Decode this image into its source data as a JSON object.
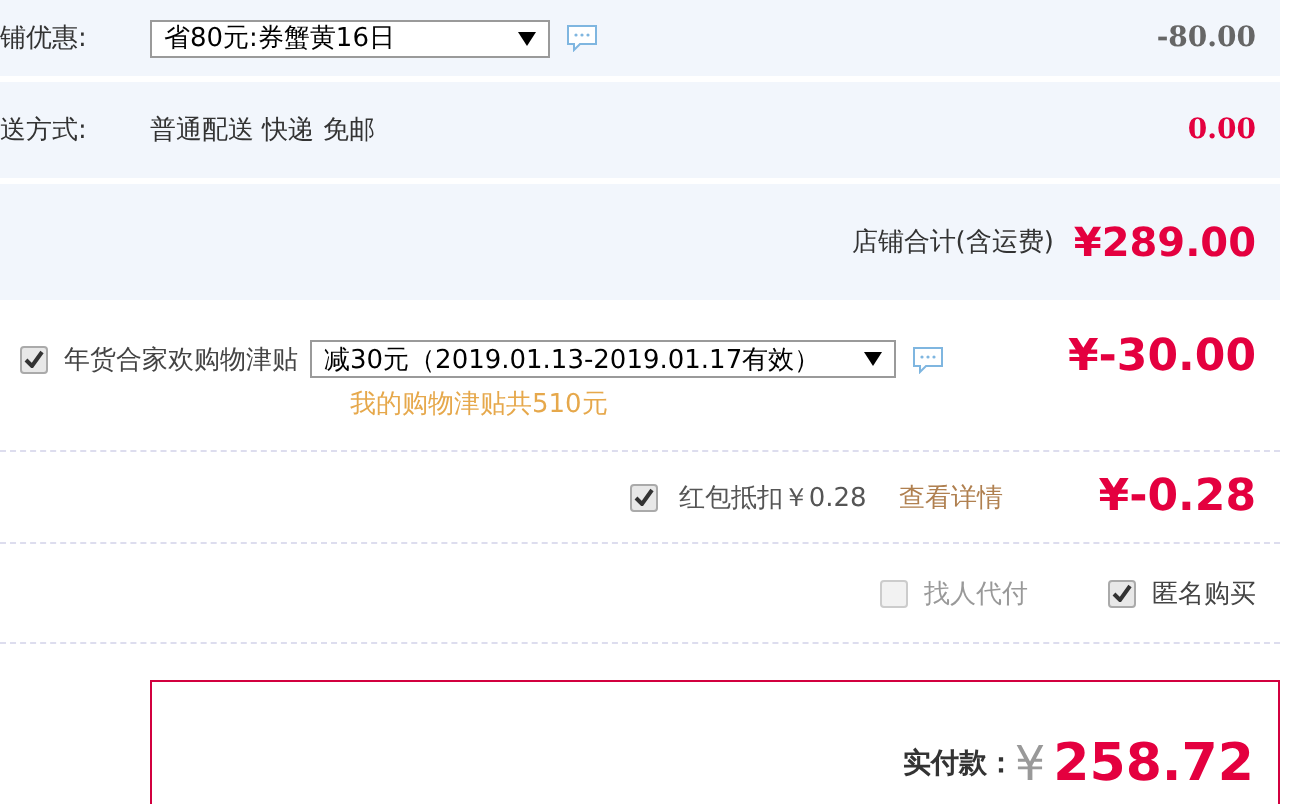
{
  "shop_discount": {
    "label": "铺优惠:",
    "select_value": "省80元:券蟹黄16日",
    "amount": "-80.00"
  },
  "shipping": {
    "label": "送方式:",
    "value": "普通配送 快递 免邮",
    "amount": "0.00"
  },
  "shop_total": {
    "label": "店铺合计(含运费)",
    "amount": "¥289.00"
  },
  "subsidy": {
    "checked": true,
    "label": "年货合家欢购物津贴",
    "select_value": "减30元（2019.01.13-2019.01.17有效）",
    "note": "我的购物津贴共510元",
    "amount": "¥-30.00"
  },
  "red_packet": {
    "checked": true,
    "label": "红包抵扣￥0.28",
    "link": "查看详情",
    "amount": "¥-0.28"
  },
  "options": [
    {
      "label": "找人代付",
      "checked": false
    },
    {
      "label": "匿名购买",
      "checked": true
    }
  ],
  "payment": {
    "label": "实付款：",
    "currency": "¥",
    "amount": "258.72"
  }
}
